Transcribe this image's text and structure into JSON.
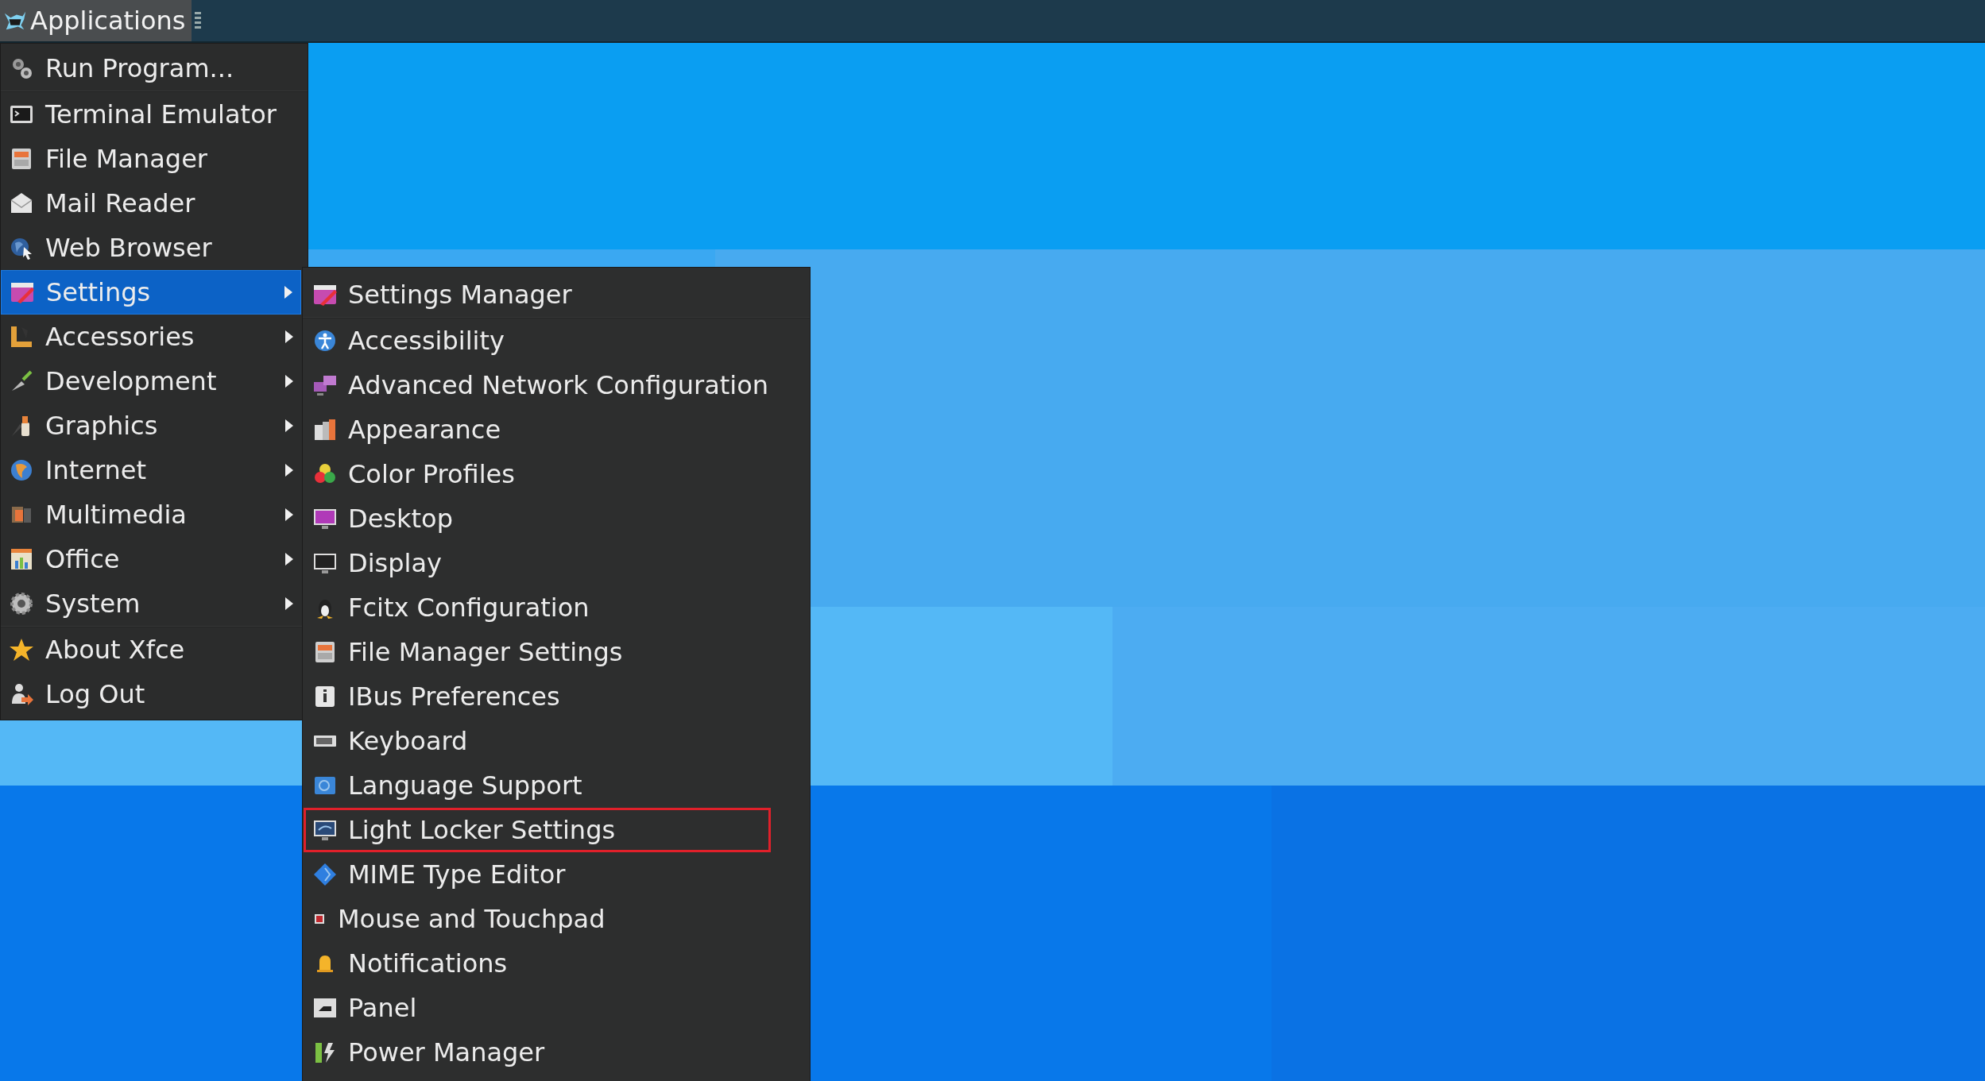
{
  "panel": {
    "applications_button": {
      "label": "Applications",
      "selected": true
    }
  },
  "menu": {
    "items": [
      {
        "kind": "item",
        "label": "Run Program...",
        "selected": false
      },
      {
        "kind": "separator"
      },
      {
        "kind": "item",
        "label": "Terminal Emulator",
        "selected": false
      },
      {
        "kind": "item",
        "label": "File Manager",
        "selected": false
      },
      {
        "kind": "item",
        "label": "Mail Reader",
        "selected": false
      },
      {
        "kind": "item",
        "label": "Web Browser",
        "selected": false
      },
      {
        "kind": "submenu",
        "label": "Settings",
        "selected": true
      },
      {
        "kind": "submenu",
        "label": "Accessories",
        "selected": false
      },
      {
        "kind": "submenu",
        "label": "Development",
        "selected": false
      },
      {
        "kind": "submenu",
        "label": "Graphics",
        "selected": false
      },
      {
        "kind": "submenu",
        "label": "Internet",
        "selected": false
      },
      {
        "kind": "submenu",
        "label": "Multimedia",
        "selected": false
      },
      {
        "kind": "submenu",
        "label": "Office",
        "selected": false
      },
      {
        "kind": "submenu",
        "label": "System",
        "selected": false
      },
      {
        "kind": "separator"
      },
      {
        "kind": "item",
        "label": "About Xfce",
        "selected": false
      },
      {
        "kind": "item",
        "label": "Log Out",
        "selected": false
      }
    ]
  },
  "submenu": {
    "items": [
      {
        "kind": "item",
        "label": "Settings Manager",
        "highlighted": false
      },
      {
        "kind": "separator"
      },
      {
        "kind": "item",
        "label": "Accessibility",
        "highlighted": false
      },
      {
        "kind": "item",
        "label": "Advanced Network Configuration",
        "highlighted": false
      },
      {
        "kind": "item",
        "label": "Appearance",
        "highlighted": false
      },
      {
        "kind": "item",
        "label": "Color Profiles",
        "highlighted": false
      },
      {
        "kind": "item",
        "label": "Desktop",
        "highlighted": false
      },
      {
        "kind": "item",
        "label": "Display",
        "highlighted": false
      },
      {
        "kind": "item",
        "label": "Fcitx Configuration",
        "highlighted": false
      },
      {
        "kind": "item",
        "label": "File Manager Settings",
        "highlighted": false
      },
      {
        "kind": "item",
        "label": "IBus Preferences",
        "highlighted": false
      },
      {
        "kind": "item",
        "label": "Keyboard",
        "highlighted": false
      },
      {
        "kind": "item",
        "label": "Language Support",
        "highlighted": false
      },
      {
        "kind": "item",
        "label": "Light Locker Settings",
        "highlighted": true
      },
      {
        "kind": "item",
        "label": "MIME Type Editor",
        "highlighted": false
      },
      {
        "kind": "item",
        "label": "Mouse and Touchpad",
        "highlighted": false
      },
      {
        "kind": "item",
        "label": "Notifications",
        "highlighted": false
      },
      {
        "kind": "item",
        "label": "Panel",
        "highlighted": false
      },
      {
        "kind": "item",
        "label": "Power Manager",
        "highlighted": false
      }
    ]
  }
}
